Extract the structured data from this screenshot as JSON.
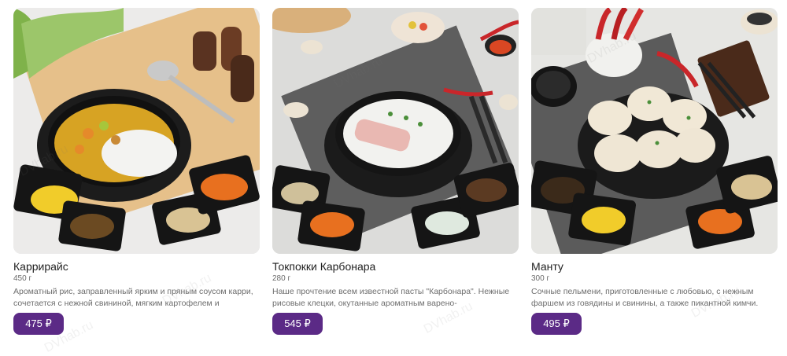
{
  "products": [
    {
      "name": "Каррирайс",
      "weight": "450 г",
      "description": "Ароматный рис, заправленный ярким и пряным соусом карри, сочетается с нежной свининой, мягким картофелем и",
      "price": "475 ₽"
    },
    {
      "name": "Токпокки Карбонара",
      "weight": "280 г",
      "description": "Наше прочтение всем известной пасты \"Карбонара\". Нежные рисовые клецки, окутанные ароматным варено-",
      "price": "545 ₽"
    },
    {
      "name": "Манту",
      "weight": "300 г",
      "description": "Сочные пельмени, приготовленные с любовью, с нежным фаршем из говядины и свинины, а также пикантной кимчи.",
      "price": "495 ₽"
    }
  ],
  "watermark": "DVhab.ru"
}
